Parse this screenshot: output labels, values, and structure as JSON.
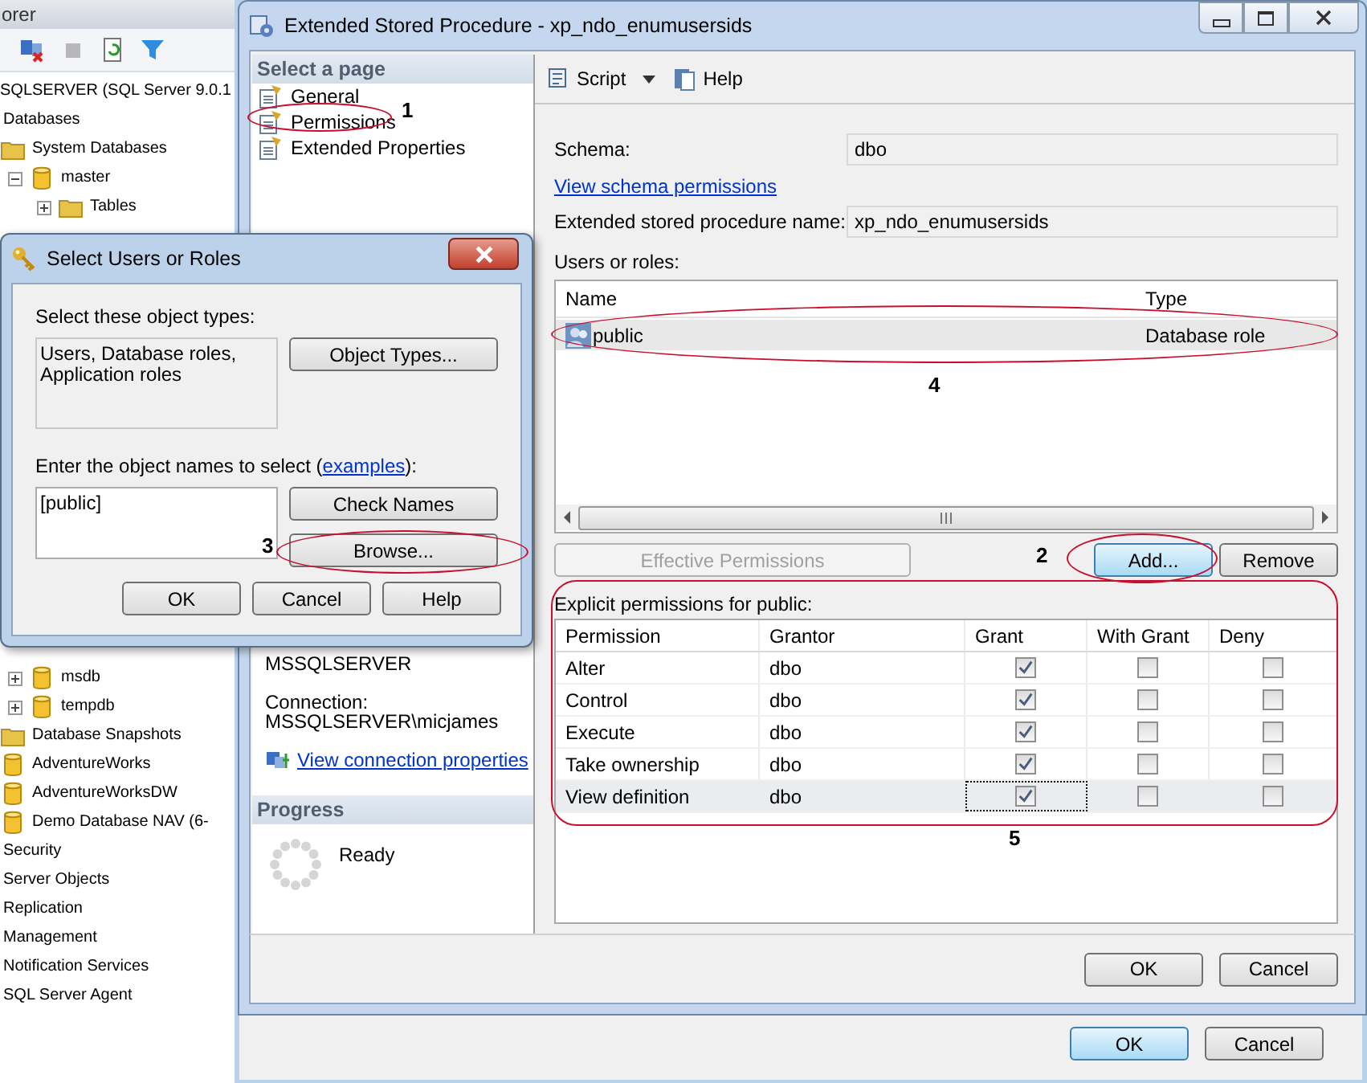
{
  "explorer": {
    "title": "orer",
    "tree": [
      {
        "label": "SQLSERVER (SQL Server 9.0.1",
        "children": [
          {
            "label": "Databases",
            "children": [
              {
                "label": "System Databases",
                "kind": "folder",
                "children": [
                  {
                    "label": "master",
                    "kind": "database",
                    "expanded": true,
                    "children": [
                      {
                        "label": "Tables",
                        "kind": "folder",
                        "expanded": false
                      }
                    ]
                  },
                  {
                    "label": "msdb",
                    "kind": "database",
                    "expanded": false
                  },
                  {
                    "label": "tempdb",
                    "kind": "database",
                    "expanded": false
                  }
                ]
              },
              {
                "label": "Database Snapshots",
                "kind": "folder"
              },
              {
                "label": "AdventureWorks",
                "kind": "database"
              },
              {
                "label": "AdventureWorksDW",
                "kind": "database"
              },
              {
                "label": "Demo Database NAV (6-",
                "kind": "database"
              }
            ]
          },
          {
            "label": "Security"
          },
          {
            "label": "Server Objects"
          },
          {
            "label": "Replication"
          },
          {
            "label": "Management"
          },
          {
            "label": "Notification Services"
          },
          {
            "label": "SQL Server Agent"
          }
        ]
      }
    ]
  },
  "back_window": {
    "buttons": [
      {
        "label": "OK",
        "default": true
      },
      {
        "label": "Cancel",
        "default": false
      }
    ]
  },
  "dialog": {
    "title": "Extended Stored Procedure - xp_ndo_enumusersids",
    "pages_title": "Select a page",
    "pages": [
      {
        "label": "General"
      },
      {
        "label": "Permissions"
      },
      {
        "label": "Extended Properties"
      }
    ],
    "server": "MSSQLSERVER",
    "connection_label": "Connection:",
    "connection": "MSSQLSERVER\\micjames",
    "connection_link": "View connection properties",
    "progress_title": "Progress",
    "progress_status": "Ready",
    "toolbar": [
      {
        "label": "Script",
        "kind": "script"
      },
      {
        "label": "Help",
        "kind": "help"
      }
    ],
    "schema_label": "Schema:",
    "schema": "dbo",
    "schema_link": "View schema permissions",
    "name_label": "Extended stored procedure name:",
    "name": "xp_ndo_enumusersids",
    "users_label": "Users or roles:",
    "users_table": {
      "columns": [
        "Name",
        "Type"
      ],
      "rows": [
        {
          "name": "public",
          "type": "Database role",
          "selected": true
        }
      ]
    },
    "buttons": [
      {
        "label": "Effective Permissions",
        "disabled": true,
        "default": false
      },
      {
        "label": "Add...",
        "disabled": false,
        "default": true
      },
      {
        "label": "Remove",
        "disabled": false,
        "default": false
      }
    ],
    "permissions_label": "Explicit permissions for public:",
    "permissions": {
      "columns": [
        "Permission",
        "Grantor",
        "Grant",
        "With Grant",
        "Deny"
      ],
      "rows": [
        {
          "permission": "Alter",
          "grantor": "dbo",
          "grant": true,
          "with_grant": false,
          "deny": false,
          "selected": false
        },
        {
          "permission": "Control",
          "grantor": "dbo",
          "grant": true,
          "with_grant": false,
          "deny": false,
          "selected": false
        },
        {
          "permission": "Execute",
          "grantor": "dbo",
          "grant": true,
          "with_grant": false,
          "deny": false,
          "selected": false
        },
        {
          "permission": "Take ownership",
          "grantor": "dbo",
          "grant": true,
          "with_grant": false,
          "deny": false,
          "selected": false
        },
        {
          "permission": "View definition",
          "grantor": "dbo",
          "grant": true,
          "with_grant": false,
          "deny": false,
          "selected": true
        }
      ]
    },
    "footer_buttons": [
      "OK",
      "Cancel"
    ]
  },
  "select_dialog": {
    "title": "Select Users or Roles",
    "types_label": "Select these object types:",
    "types": "Users, Database roles, Application roles",
    "types_button": "Object Types...",
    "names_label_before": "Enter the object names to select (",
    "names_link": "examples",
    "names_label_after": "):",
    "names": "[public]",
    "check_button": "Check Names",
    "browse_button": "Browse...",
    "buttons": [
      "OK",
      "Cancel",
      "Help"
    ]
  },
  "annotations": [
    {
      "number": "1",
      "kind": "ellipse"
    },
    {
      "number": "2",
      "kind": "ellipse"
    },
    {
      "number": "3",
      "kind": "ellipse"
    },
    {
      "number": "4",
      "kind": "ellipse"
    },
    {
      "number": "5",
      "kind": "box"
    }
  ]
}
